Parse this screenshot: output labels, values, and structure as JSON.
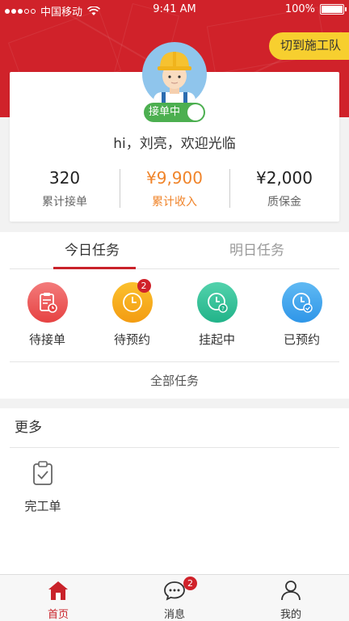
{
  "status_bar": {
    "carrier": "中国移动",
    "time": "9:41 AM",
    "battery": "100%"
  },
  "header": {
    "switch_label": "切到施工队"
  },
  "profile": {
    "status_label": "接单中",
    "greeting": "hi，刘亮，欢迎光临",
    "stats": [
      {
        "value": "320",
        "label": "累计接单"
      },
      {
        "value": "¥9,900",
        "label": "累计收入"
      },
      {
        "value": "¥2,000",
        "label": "质保金"
      }
    ]
  },
  "tasks": {
    "tabs": [
      "今日任务",
      "明日任务"
    ],
    "items": [
      {
        "label": "待接单",
        "icon": "clipboard-clock-icon",
        "badge": ""
      },
      {
        "label": "待预约",
        "icon": "clock-icon",
        "badge": "2"
      },
      {
        "label": "挂起中",
        "icon": "clock-question-icon",
        "badge": ""
      },
      {
        "label": "已预约",
        "icon": "clock-check-icon",
        "badge": ""
      }
    ],
    "all_label": "全部任务"
  },
  "more": {
    "title": "更多",
    "items": [
      {
        "label": "完工单",
        "icon": "clipboard-check-icon"
      }
    ]
  },
  "tabbar": {
    "items": [
      {
        "label": "首页",
        "icon": "home-icon"
      },
      {
        "label": "消息",
        "icon": "message-icon",
        "badge": "2"
      },
      {
        "label": "我的",
        "icon": "user-icon"
      }
    ]
  },
  "colors": {
    "brand_red": "#d0222a",
    "accent_orange": "#f0842a",
    "switch_yellow": "#f7cf2f",
    "online_green": "#4caf50"
  }
}
